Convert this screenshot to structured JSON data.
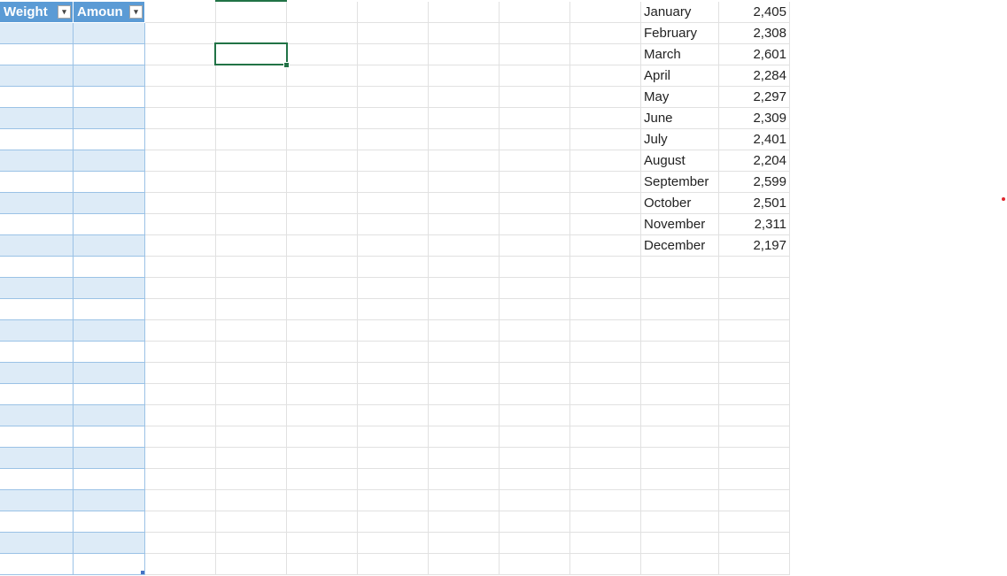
{
  "table": {
    "headers": [
      "Weight",
      "Amoun"
    ],
    "band_rows": 26
  },
  "months": [
    {
      "name": "January",
      "value": "2,405"
    },
    {
      "name": "February",
      "value": "2,308"
    },
    {
      "name": "March",
      "value": "2,601"
    },
    {
      "name": "April",
      "value": "2,284"
    },
    {
      "name": "May",
      "value": "2,297"
    },
    {
      "name": "June",
      "value": "2,309"
    },
    {
      "name": "July",
      "value": "2,401"
    },
    {
      "name": "August",
      "value": "2,204"
    },
    {
      "name": "September",
      "value": "2,599"
    },
    {
      "name": "October",
      "value": "2,501"
    },
    {
      "name": "November",
      "value": "2,311"
    },
    {
      "name": "December",
      "value": "2,197"
    }
  ],
  "colors": {
    "header": "#5b9bd5",
    "band": "#ddebf7",
    "selection": "#217346",
    "gridline": "#e1e1e1"
  }
}
